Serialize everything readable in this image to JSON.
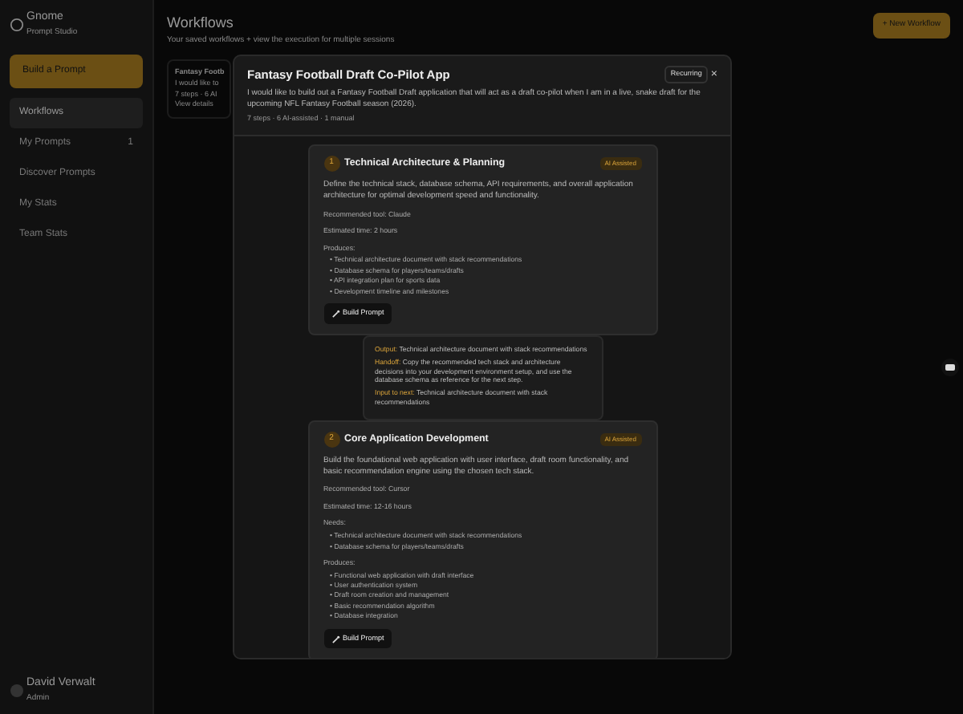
{
  "sidebar": {
    "brand": "Gnome",
    "brand_subtitle": "Prompt Studio",
    "build_button": "Build a Prompt",
    "items": [
      {
        "label": "Workflows",
        "selected": true
      },
      {
        "label": "My Prompts",
        "selected": false,
        "badge": "1"
      },
      {
        "label": "Discover Prompts",
        "selected": false
      },
      {
        "label": "My Stats",
        "selected": false
      },
      {
        "label": "Team Stats",
        "selected": false
      }
    ],
    "user": {
      "name": "David Verwalt",
      "role": "Admin"
    }
  },
  "page": {
    "title": "Workflows",
    "subtitle": "Your saved workflows + view the execution for multiple sessions",
    "new_button": "+ New Workflow",
    "card": {
      "title": "Fantasy Footb",
      "text": "I would like to",
      "meta": "7 steps · 6 AI",
      "link": "View details"
    }
  },
  "modal": {
    "title": "Fantasy Football Draft Co-Pilot App",
    "recurring": "Recurring",
    "close": "×",
    "description": "I would like to build out a Fantasy Football Draft application that will act as a draft co-pilot when I am in a live, snake draft for the upcoming NFL Fantasy Football season (2026).",
    "meta": "7 steps · 6 AI-assisted · 1 manual",
    "steps": [
      {
        "number": "1",
        "title": "Technical Architecture & Planning",
        "tag": "AI Assisted",
        "description": "Define the technical stack, database schema, API requirements, and overall application architecture for optimal development speed and functionality.",
        "tool": "Recommended tool: Claude",
        "time": "Estimated time: 2 hours",
        "produces_label": "Produces:",
        "produces": [
          "• Technical architecture document with stack recommendations",
          "• Database schema for players/teams/drafts",
          "• API integration plan for sports data",
          "• Development timeline and milestones"
        ],
        "button": "Build Prompt",
        "handoff": {
          "output_label": "Output:",
          "output": "Technical architecture document with stack recommendations",
          "handoff_label": "Handoff:",
          "handoff": "Copy the recommended tech stack and architecture decisions into your development environment setup, and use the database schema as reference for the next step.",
          "input_label": "Input to next:",
          "input": "Technical architecture document with stack recommendations"
        }
      },
      {
        "number": "2",
        "title": "Core Application Development",
        "tag": "AI Assisted",
        "description": "Build the foundational web application with user interface, draft room functionality, and basic recommendation engine using the chosen tech stack.",
        "tool": "Recommended tool: Cursor",
        "time": "Estimated time: 12-16 hours",
        "needs_label": "Needs:",
        "needs": [
          "• Technical architecture document with stack recommendations",
          "• Database schema for players/teams/drafts"
        ],
        "produces_label": "Produces:",
        "produces": [
          "• Functional web application with draft interface",
          "• User authentication system",
          "• Draft room creation and management",
          "• Basic recommendation algorithm",
          "• Database integration"
        ],
        "button": "Build Prompt"
      }
    ]
  }
}
